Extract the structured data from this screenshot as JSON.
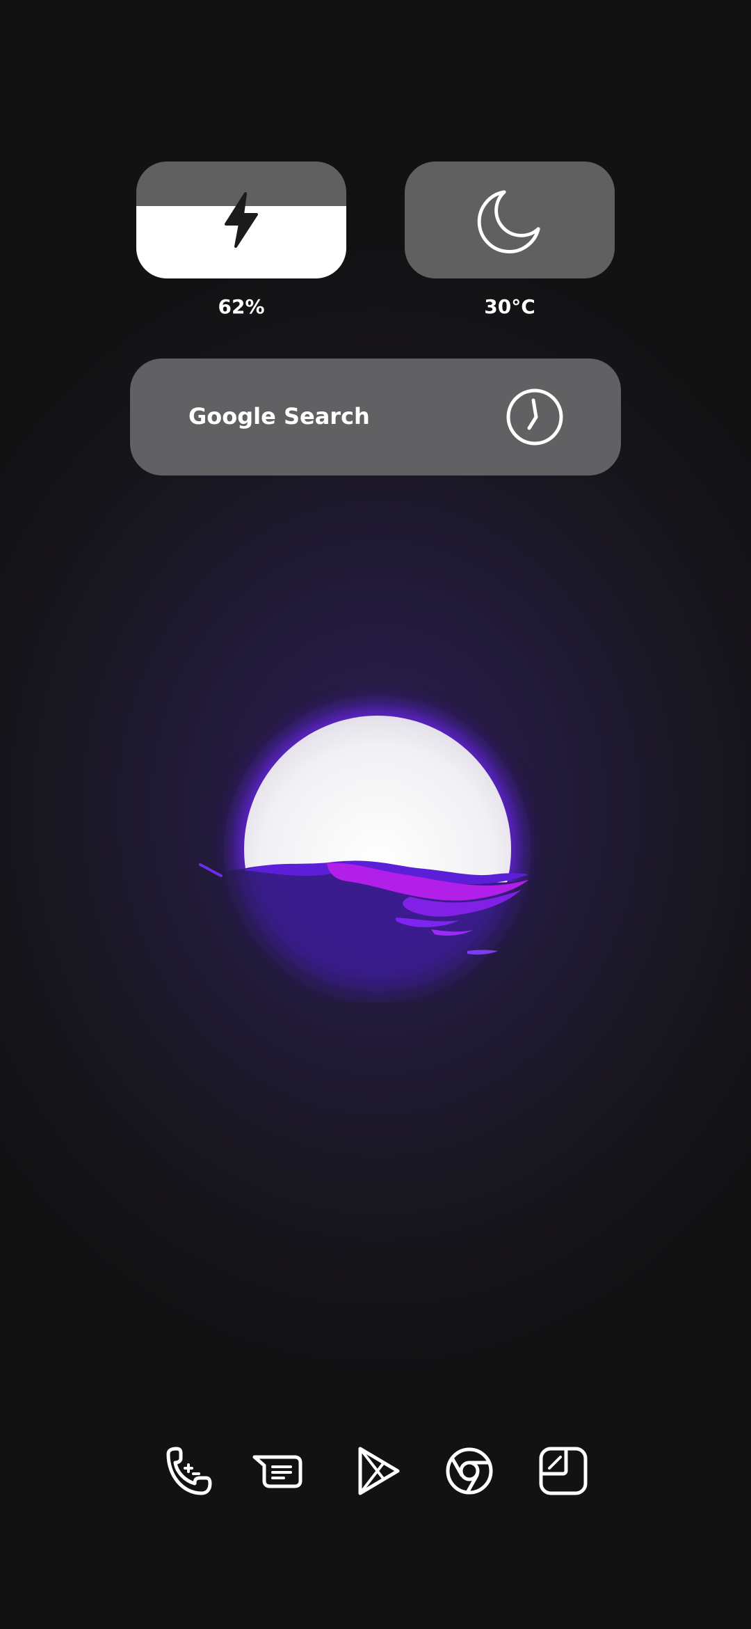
{
  "widgets": {
    "battery": {
      "level_percent": 62,
      "label": "62%",
      "icon": "lightning-bolt-icon"
    },
    "weather": {
      "label": "30°C",
      "icon": "moon-icon"
    },
    "search": {
      "label": "Google Search",
      "icon": "clock-icon"
    }
  },
  "dock": {
    "apps": [
      {
        "name": "Phone",
        "icon": "phone-icon"
      },
      {
        "name": "Messages",
        "icon": "message-icon"
      },
      {
        "name": "Play Store",
        "icon": "play-store-icon"
      },
      {
        "name": "Chrome",
        "icon": "chrome-icon"
      },
      {
        "name": "Gallery",
        "icon": "gallery-icon"
      }
    ]
  },
  "colors": {
    "background": "#121213",
    "widget": "#606060",
    "accent_glow": "#7a2cff",
    "water": "#b21fe8"
  }
}
